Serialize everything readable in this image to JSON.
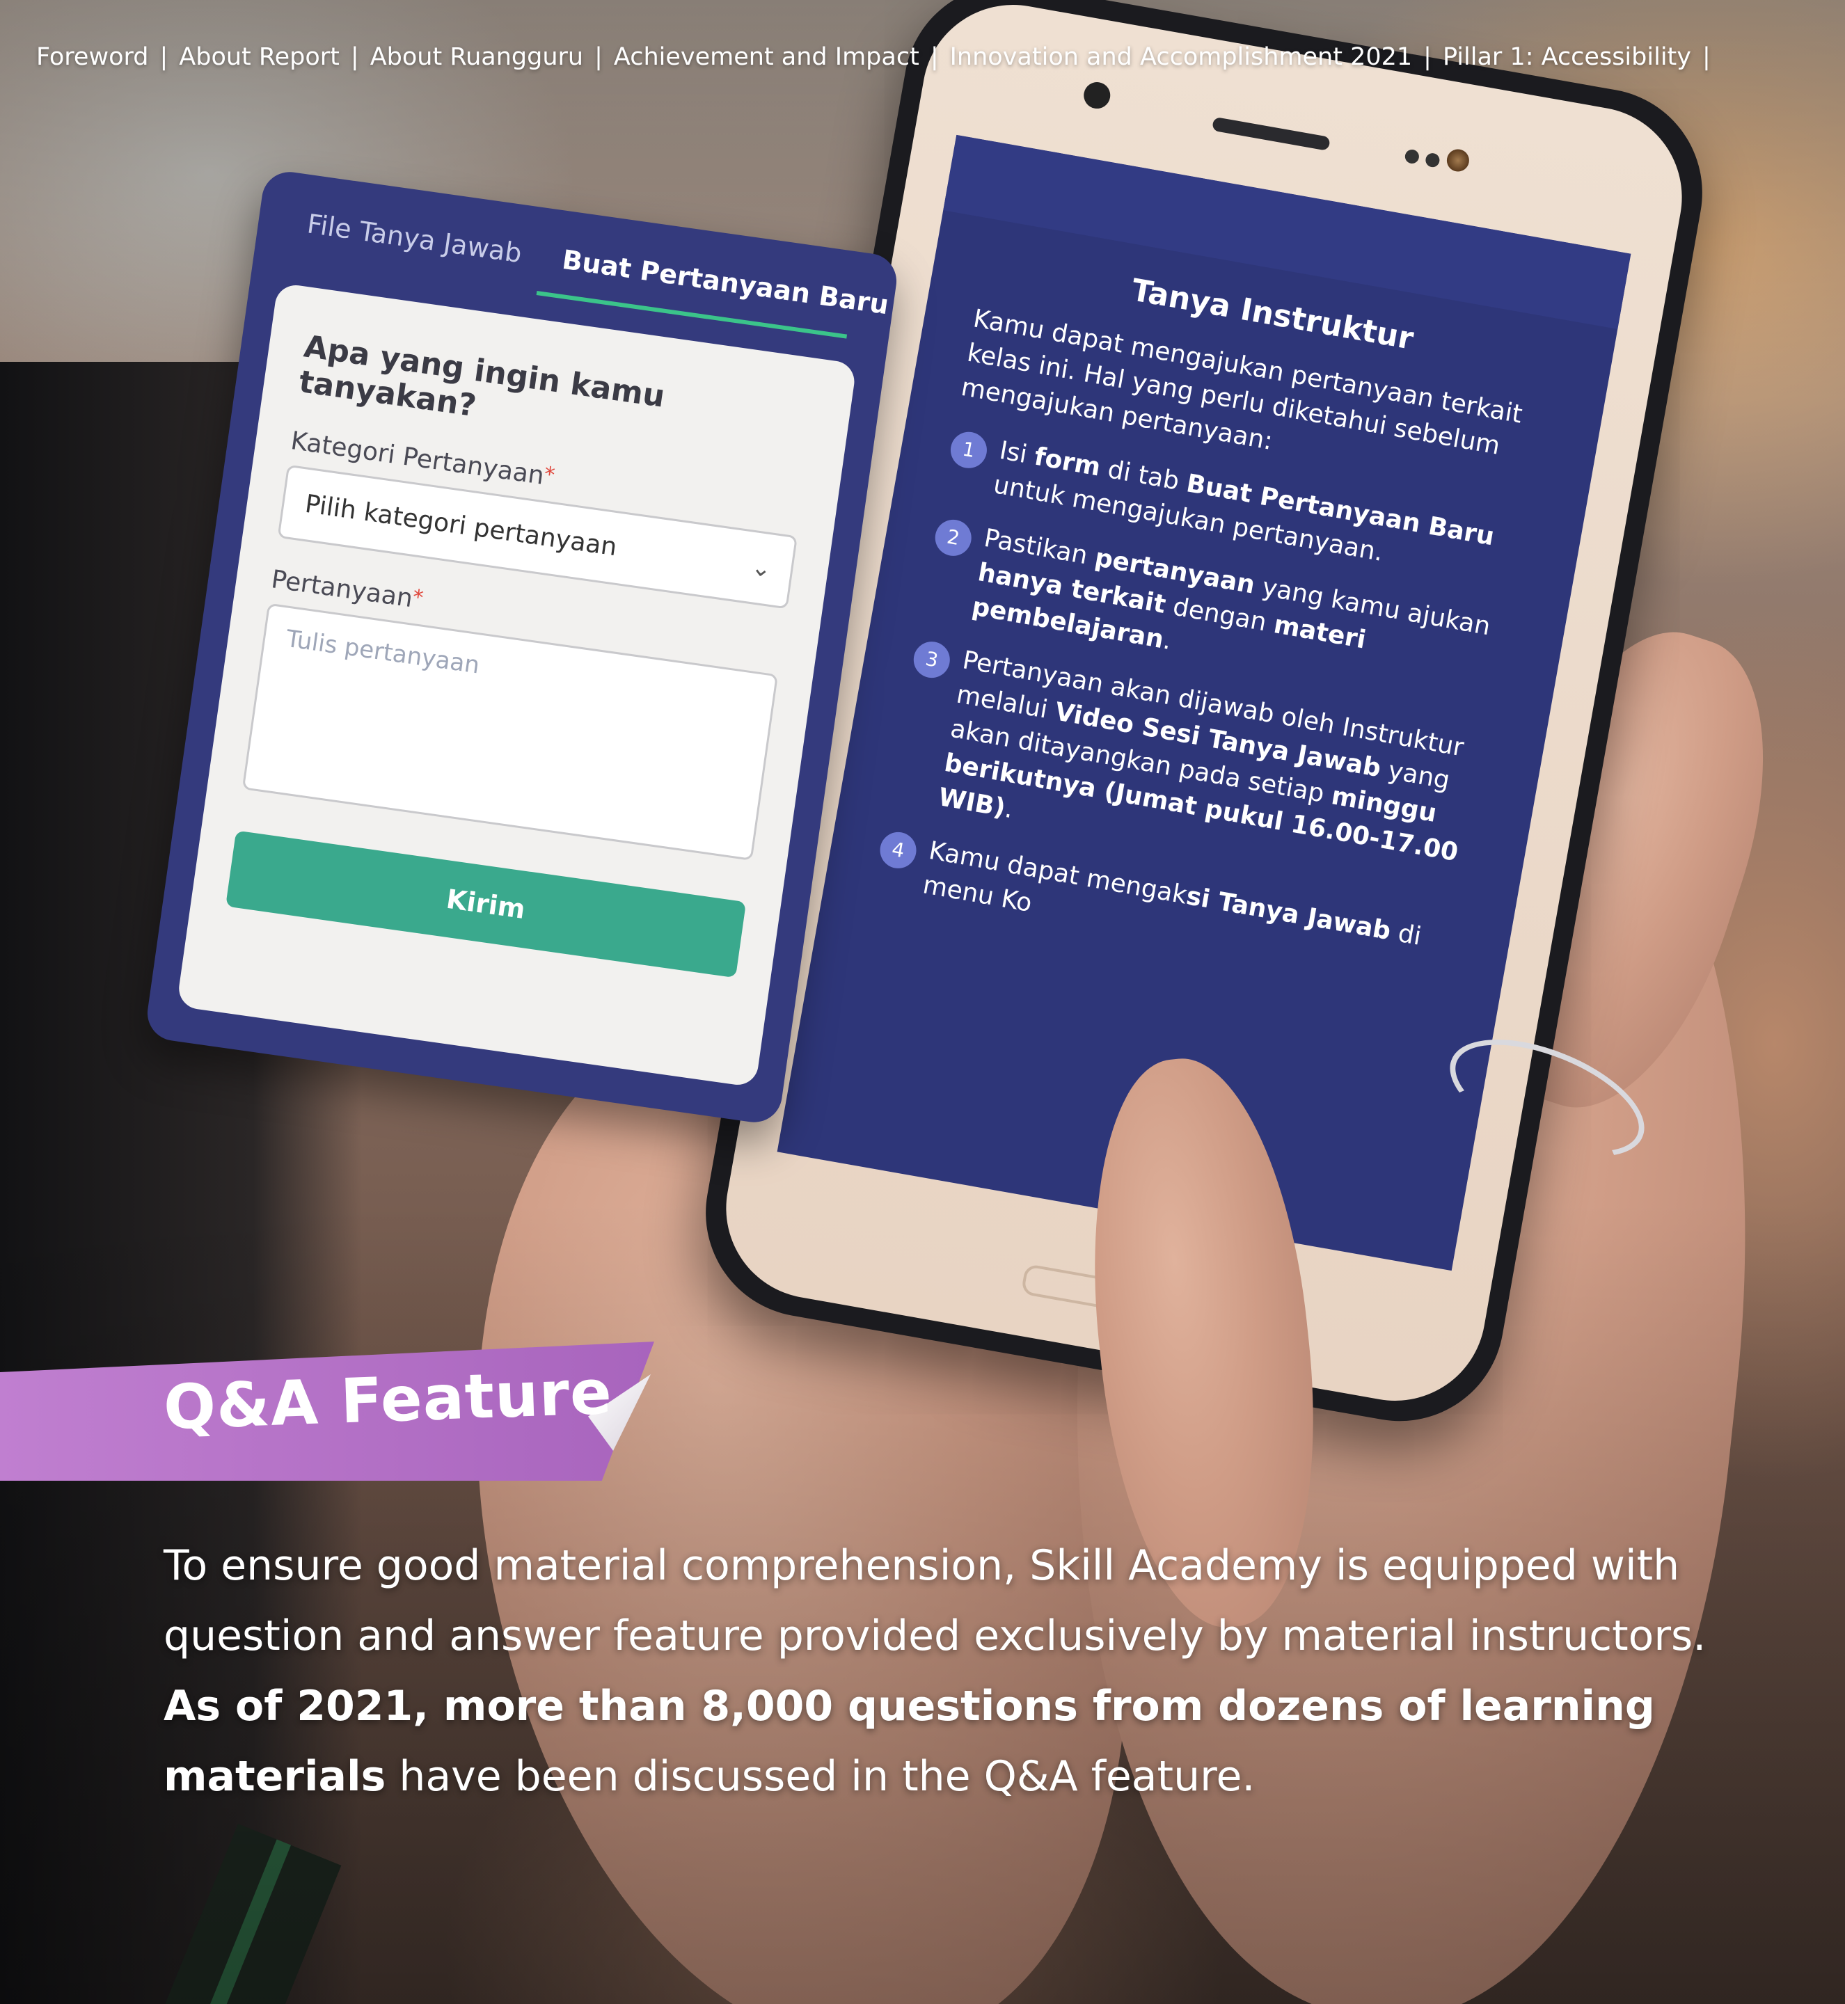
{
  "nav": {
    "items": [
      "Foreword",
      "About Report",
      "About Ruangguru",
      "Achievement and Impact",
      "Innovation and Accomplishment 2021",
      "Pillar 1: Accessibility"
    ],
    "separator": "|"
  },
  "form_card": {
    "tab_1": "File Tanya Jawab",
    "tab_2": "Buat Pertanyaan Baru",
    "heading": "Apa yang ingin kamu tanyakan?",
    "category_label": "Kategori Pertanyaan",
    "category_placeholder": "Pilih kategori pertanyaan",
    "question_label": "Pertanyaan",
    "required_mark": "*",
    "question_placeholder": "Tulis pertanyaan",
    "submit_label": "Kirim"
  },
  "phone_screen": {
    "title": "Tanya Instruktur",
    "intro": "Kamu dapat mengajukan pertanyaan terkait kelas ini. Hal yang perlu diketahui sebelum mengajukan pertanyaan:",
    "steps": [
      {
        "num": "1",
        "a": "Isi ",
        "b1": "form",
        "c": " di tab ",
        "b2": "Buat Pertanyaan Baru",
        "d": " untuk mengajukan pertanyaan."
      },
      {
        "num": "2",
        "a": "Pastikan ",
        "b1": "pertanyaan",
        "c": " yang kamu ajukan ",
        "b2": "hanya terkait",
        "d": " dengan ",
        "b3": "materi pembelajaran",
        "e": "."
      },
      {
        "num": "3",
        "a": "Pertanyaan akan dijawab oleh Instruktur melalui ",
        "b1": "Video Sesi Tanya Jawab",
        "c": " yang akan ditayangkan pada setiap ",
        "b2": "minggu berikutnya (Jumat pukul 16.00-17.00 WIB)",
        "d": "."
      },
      {
        "num": "4",
        "a": "Kamu dapat mengak",
        "b1": "si Tanya Jawab",
        "c": " di menu Ko"
      }
    ]
  },
  "ribbon": {
    "title": "Q&A Feature"
  },
  "paragraph": {
    "p1": "To ensure good material comprehension, Skill Academy is equipped with question and answer feature provided exclusively by material instructors. ",
    "bold": "As of 2021, more than 8,000 questions from dozens of learning materials",
    "p2": " have been discussed in the Q&A feature."
  },
  "colors": {
    "ribbon": "#b06ec4",
    "card_bg": "#343a7d",
    "screen_bg": "#2e3679",
    "submit_button": "#3aa98d",
    "tab_underline": "#3bc48a"
  }
}
